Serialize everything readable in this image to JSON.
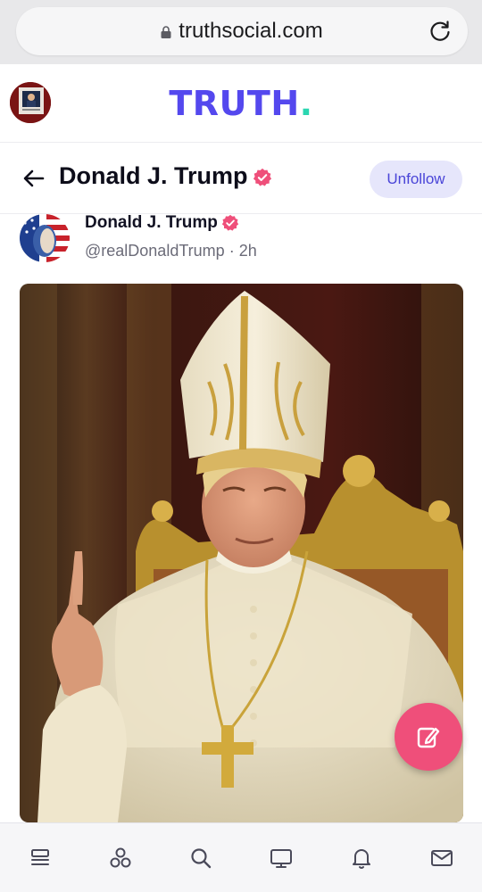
{
  "browser": {
    "url": "truthsocial.com",
    "icons": [
      "lock-icon",
      "reload-icon"
    ]
  },
  "header": {
    "logo_text": "TRUTH",
    "logo_dot": ".",
    "colors": {
      "logo": "#5448ee",
      "logo_dot": "#2ad6b0"
    }
  },
  "profile": {
    "name": "Donald J. Trump",
    "unfollow_label": "Unfollow",
    "verified_color": "#ef4f7a"
  },
  "post": {
    "author_name": "Donald J. Trump",
    "handle": "@realDonaldTrump",
    "separator": "·",
    "time": "2h"
  },
  "fab": {
    "icon": "compose-icon",
    "color": "#ef4f7a"
  },
  "bottom_nav": {
    "items": [
      "home-icon",
      "groups-icon",
      "search-icon",
      "tv-icon",
      "notifications-icon",
      "messages-icon"
    ]
  }
}
